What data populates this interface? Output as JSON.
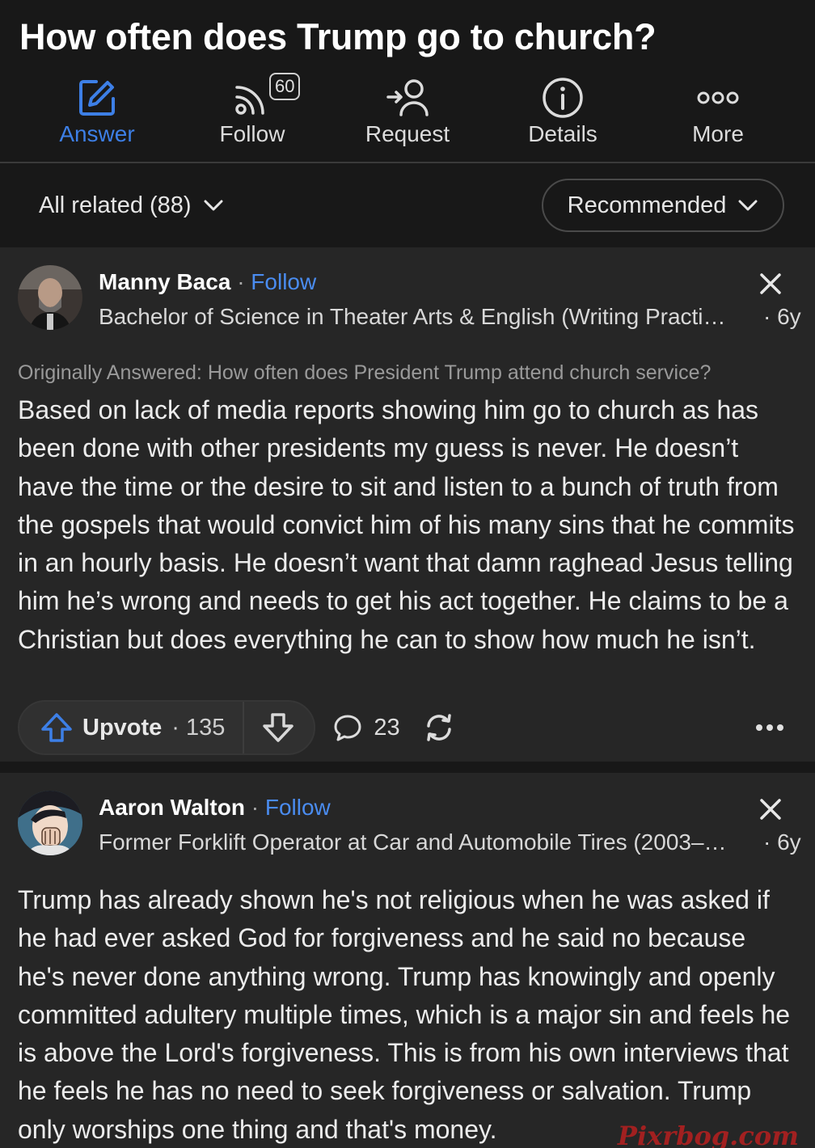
{
  "question": {
    "title": "How often does Trump go to church?"
  },
  "actions": [
    {
      "label": "Answer",
      "icon": "answer-pencil-icon"
    },
    {
      "label": "Follow",
      "icon": "follow-feed-icon",
      "badge": "60"
    },
    {
      "label": "Request",
      "icon": "request-person-icon"
    },
    {
      "label": "Details",
      "icon": "info-icon"
    },
    {
      "label": "More",
      "icon": "more-dots-icon"
    }
  ],
  "filters": {
    "all_related": "All related (88)",
    "sort": "Recommended"
  },
  "answers": [
    {
      "author": "Manny Baca",
      "follow_label": "Follow",
      "credential": "Bachelor of Science in Theater Arts & English (Writing Practi…",
      "age": "· 6y",
      "originally_answered": "Originally Answered: How often does President Trump attend church service?",
      "text": "Based on lack of media reports showing him go to church as has been done with other presidents my guess is never. He doesn’t have the time or the desire to sit and listen to a bunch of truth from the gospels that would convict him of his many sins that he commits in an hourly basis. He doesn’t want that damn raghead Jesus telling him he’s wrong and needs to get his act together. He claims to be a Christian but does everything he can to show how much he isn’t.",
      "upvote_label": "Upvote",
      "upvote_count": "· 135",
      "comment_count": "23"
    },
    {
      "author": "Aaron Walton",
      "follow_label": "Follow",
      "credential": "Former Forklift Operator at Car and Automobile Tires (2003–…",
      "age": "· 6y",
      "text": "Trump has already shown he's not religious when he was asked if he had ever asked God for forgiveness and he said no because he's never done anything wrong. Trump has knowingly and openly committed adultery multiple times, which is a major sin and feels he is above the Lord's forgiveness. This is from his own interviews that he feels he has no need to seek forgiveness or salvation. Trump only worships one thing and that's money."
    }
  ],
  "watermark": "Pixrbog.com",
  "colors": {
    "accent": "#3d7fe6",
    "background": "#181818",
    "card": "#262626"
  }
}
